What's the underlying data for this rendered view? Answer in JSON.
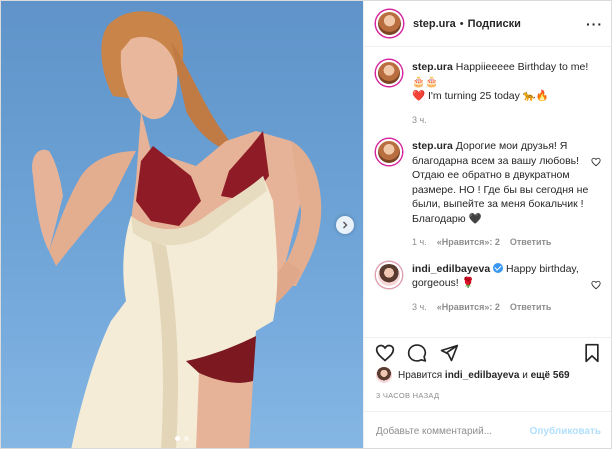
{
  "header": {
    "username": "step.ura",
    "separator": "•",
    "follow_label": "Подписки",
    "more_label": "···"
  },
  "comments": [
    {
      "username": "step.ura",
      "line1": "Happiieeeee Birthday to me!",
      "line1_emoji": "🎂🎂",
      "line2_prefix": "❤️",
      "line2": "I'm turning 25 today",
      "line2_suffix": "🐆🔥",
      "time": "3 ч."
    },
    {
      "username": "step.ura",
      "text": "Дорогие мои друзья! Я благодарна всем за вашу любовь! Отдаю ее обратно в двукратном размере. НО ! Где бы вы сегодня не были, выпейте за меня бокальчик ! Благодарю",
      "text_suffix": "🖤",
      "time": "1 ч.",
      "likes": "«Нравится»: 2",
      "reply": "Ответить"
    },
    {
      "username": "indi_edilbayeva",
      "text": "Happy birthday, gorgeous!",
      "text_suffix": "🌹",
      "time": "3 ч.",
      "likes": "«Нравится»: 2",
      "reply": "Ответить"
    }
  ],
  "likes": {
    "prefix": "Нравится",
    "user": "indi_edilbayeva",
    "conj": "и",
    "others": "ещё 569"
  },
  "posted": "3 ЧАСОВ НАЗАД",
  "add_comment": {
    "placeholder": "Добавьте комментарий...",
    "publish_label": "Опубликовать"
  },
  "carousel": {
    "count": 2,
    "active_index": 0
  },
  "colors": {
    "accent": "#3897f0",
    "publish_disabled": "#b2dffc",
    "sky": "#6aa0d4",
    "dress": "#f4ecd7",
    "bra": "#8e1b26"
  }
}
